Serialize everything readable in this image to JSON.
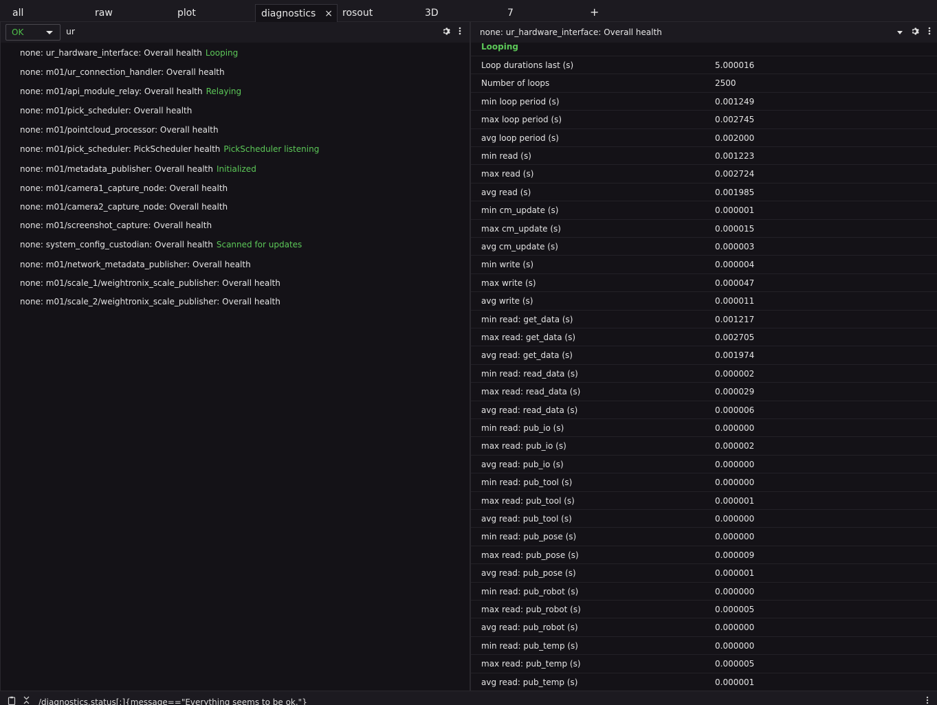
{
  "tabs": [
    {
      "label": "all"
    },
    {
      "label": "raw"
    },
    {
      "label": "plot"
    },
    {
      "label": "diagnostics"
    },
    {
      "label": "rosout"
    },
    {
      "label": "3D"
    },
    {
      "label": "7"
    }
  ],
  "tab_add": "+",
  "tab_close": "×",
  "left": {
    "level_select": "OK",
    "filter_text": "ur",
    "items": [
      {
        "name": "none: ur_hardware_interface: Overall health",
        "message": "Looping"
      },
      {
        "name": "none: m01/ur_connection_handler: Overall health",
        "message": ""
      },
      {
        "name": "none: m01/api_module_relay: Overall health",
        "message": "Relaying"
      },
      {
        "name": "none: m01/pick_scheduler: Overall health",
        "message": ""
      },
      {
        "name": "none: m01/pointcloud_processor: Overall health",
        "message": ""
      },
      {
        "name": "none: m01/pick_scheduler: PickScheduler health",
        "message": "PickScheduler listening"
      },
      {
        "name": "none: m01/metadata_publisher: Overall health",
        "message": "Initialized"
      },
      {
        "name": "none: m01/camera1_capture_node: Overall health",
        "message": ""
      },
      {
        "name": "none: m01/camera2_capture_node: Overall health",
        "message": ""
      },
      {
        "name": "none: m01/screenshot_capture: Overall health",
        "message": ""
      },
      {
        "name": "none: system_config_custodian: Overall health",
        "message": "Scanned for updates"
      },
      {
        "name": "none: m01/network_metadata_publisher: Overall health",
        "message": ""
      },
      {
        "name": "none: m01/scale_1/weightronix_scale_publisher: Overall health",
        "message": ""
      },
      {
        "name": "none: m01/scale_2/weightronix_scale_publisher: Overall health",
        "message": ""
      }
    ]
  },
  "right": {
    "title": "none: ur_hardware_interface: Overall health",
    "status_message": "Looping",
    "rows": [
      {
        "key": "Loop durations last (s)",
        "value": "5.000016"
      },
      {
        "key": "Number of loops",
        "value": "2500"
      },
      {
        "key": "min loop period (s)",
        "value": "0.001249"
      },
      {
        "key": "max loop period (s)",
        "value": "0.002745"
      },
      {
        "key": "avg loop period (s)",
        "value": "0.002000"
      },
      {
        "key": "min read (s)",
        "value": "0.001223"
      },
      {
        "key": "max read (s)",
        "value": "0.002724"
      },
      {
        "key": "avg read (s)",
        "value": "0.001985"
      },
      {
        "key": "min cm_update (s)",
        "value": "0.000001"
      },
      {
        "key": "max cm_update (s)",
        "value": "0.000015"
      },
      {
        "key": "avg cm_update (s)",
        "value": "0.000003"
      },
      {
        "key": "min write (s)",
        "value": "0.000004"
      },
      {
        "key": "max write (s)",
        "value": "0.000047"
      },
      {
        "key": "avg write (s)",
        "value": "0.000011"
      },
      {
        "key": "min read: get_data (s)",
        "value": "0.001217"
      },
      {
        "key": "max read: get_data (s)",
        "value": "0.002705"
      },
      {
        "key": "avg read: get_data (s)",
        "value": "0.001974"
      },
      {
        "key": "min read: read_data (s)",
        "value": "0.000002"
      },
      {
        "key": "max read: read_data (s)",
        "value": "0.000029"
      },
      {
        "key": "avg read: read_data (s)",
        "value": "0.000006"
      },
      {
        "key": "min read: pub_io (s)",
        "value": "0.000000"
      },
      {
        "key": "max read: pub_io (s)",
        "value": "0.000002"
      },
      {
        "key": "avg read: pub_io (s)",
        "value": "0.000000"
      },
      {
        "key": "min read: pub_tool (s)",
        "value": "0.000000"
      },
      {
        "key": "max read: pub_tool (s)",
        "value": "0.000001"
      },
      {
        "key": "avg read: pub_tool (s)",
        "value": "0.000000"
      },
      {
        "key": "min read: pub_pose (s)",
        "value": "0.000000"
      },
      {
        "key": "max read: pub_pose (s)",
        "value": "0.000009"
      },
      {
        "key": "avg read: pub_pose (s)",
        "value": "0.000001"
      },
      {
        "key": "min read: pub_robot (s)",
        "value": "0.000000"
      },
      {
        "key": "max read: pub_robot (s)",
        "value": "0.000005"
      },
      {
        "key": "avg read: pub_robot (s)",
        "value": "0.000000"
      },
      {
        "key": "min read: pub_temp (s)",
        "value": "0.000000"
      },
      {
        "key": "max read: pub_temp (s)",
        "value": "0.000005"
      },
      {
        "key": "avg read: pub_temp (s)",
        "value": "0.000001"
      }
    ]
  },
  "statusbar": {
    "text": "/diagnostics.status[:]{message==\"Everything seems to be ok.\"}"
  },
  "colors": {
    "ok_green": "#5cc858",
    "background": "#141217",
    "panel_header": "#1c1a20"
  }
}
